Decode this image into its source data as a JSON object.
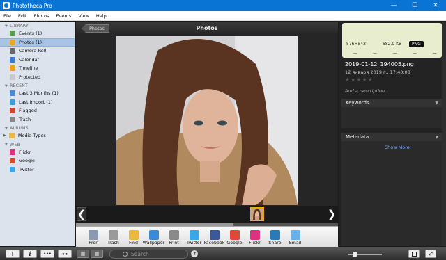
{
  "app": {
    "title": "Phototheca Pro"
  },
  "window_controls": {
    "minimize": "—",
    "maximize": "☐",
    "close": "✕"
  },
  "menu": [
    "File",
    "Edit",
    "Photos",
    "Events",
    "View",
    "Help"
  ],
  "sidebar": {
    "library_header": "LIBRARY",
    "library_items": [
      {
        "label": "Events (1)",
        "icon": "events-icon",
        "color": "#5aa04a"
      },
      {
        "label": "Photos (1)",
        "icon": "photos-icon",
        "color": "#e8a820",
        "selected": true
      },
      {
        "label": "Camera Roll",
        "icon": "camera-roll-icon",
        "color": "#6a6a6a"
      },
      {
        "label": "Calendar",
        "icon": "calendar-icon",
        "color": "#3d7ad8"
      },
      {
        "label": "Timeline",
        "icon": "timeline-icon",
        "color": "#f0a020"
      },
      {
        "label": "Protected",
        "icon": "protected-icon",
        "color": "#c8c8c8"
      }
    ],
    "recent_header": "RECENT",
    "recent_items": [
      {
        "label": "Last 3 Months (1)",
        "icon": "clock-icon",
        "color": "#4a8ad8"
      },
      {
        "label": "Last Import (1)",
        "icon": "import-icon",
        "color": "#3aa0d8"
      },
      {
        "label": "Flagged",
        "icon": "flag-icon",
        "color": "#d84030"
      },
      {
        "label": "Trash",
        "icon": "trash-icon",
        "color": "#888888"
      }
    ],
    "albums_header": "ALBUMS",
    "album_items": [
      {
        "label": "Media Types",
        "icon": "folder-icon",
        "color": "#e8b840"
      }
    ],
    "web_header": "WEB",
    "web_items": [
      {
        "label": "Flickr",
        "icon": "flickr-icon",
        "color": "#e03080"
      },
      {
        "label": "Google",
        "icon": "google-icon",
        "color": "#d84a30"
      },
      {
        "label": "Twitter",
        "icon": "twitter-icon",
        "color": "#3aa8e8"
      }
    ]
  },
  "viewer": {
    "back_label": "Photos",
    "title": "Photos",
    "nav_prev": "❮",
    "nav_next": "❯"
  },
  "toolbar": {
    "tools": [
      {
        "label": "Pror",
        "icon": "print-preview-icon",
        "color": "#8a9ab0"
      },
      {
        "label": "Trash",
        "icon": "trash-icon",
        "color": "#9a9a9a"
      },
      {
        "label": "Find",
        "icon": "find-icon",
        "color": "#e8b840"
      },
      {
        "label": "Wallpaper",
        "icon": "wallpaper-icon",
        "color": "#3a8ad8"
      },
      {
        "label": "Print",
        "icon": "print-icon",
        "color": "#8a8a8a"
      },
      {
        "label": "Twitter",
        "icon": "twitter-icon",
        "color": "#3aa8e8"
      },
      {
        "label": "Facebook",
        "icon": "facebook-icon",
        "color": "#3b5998"
      },
      {
        "label": "Google",
        "icon": "google-icon",
        "color": "#e0483a"
      },
      {
        "label": "Flickr",
        "icon": "flickr-icon",
        "color": "#e03080"
      },
      {
        "label": "Share",
        "icon": "share-icon",
        "color": "#2a7ab8"
      },
      {
        "label": "Email",
        "icon": "email-icon",
        "color": "#6ab0e8"
      }
    ]
  },
  "info": {
    "dimensions": "576×543",
    "filesize": "682.9 KB",
    "format": "PNG",
    "stats": [
      "—",
      "—",
      "—",
      "—",
      "—"
    ],
    "filename": "2019-01-12_194005.png",
    "date": "12 января 2019 г., 17:40:08",
    "stars": "★★★★★",
    "description_placeholder": "Add a description...",
    "keywords_header": "Keywords",
    "metadata_header": "Metadata",
    "show_more": "Show More"
  },
  "bottombar": {
    "add_label": "+",
    "info_label": "i",
    "more_label": "•••",
    "key_label": "⊶",
    "search_placeholder": "Search",
    "help_label": "?"
  }
}
